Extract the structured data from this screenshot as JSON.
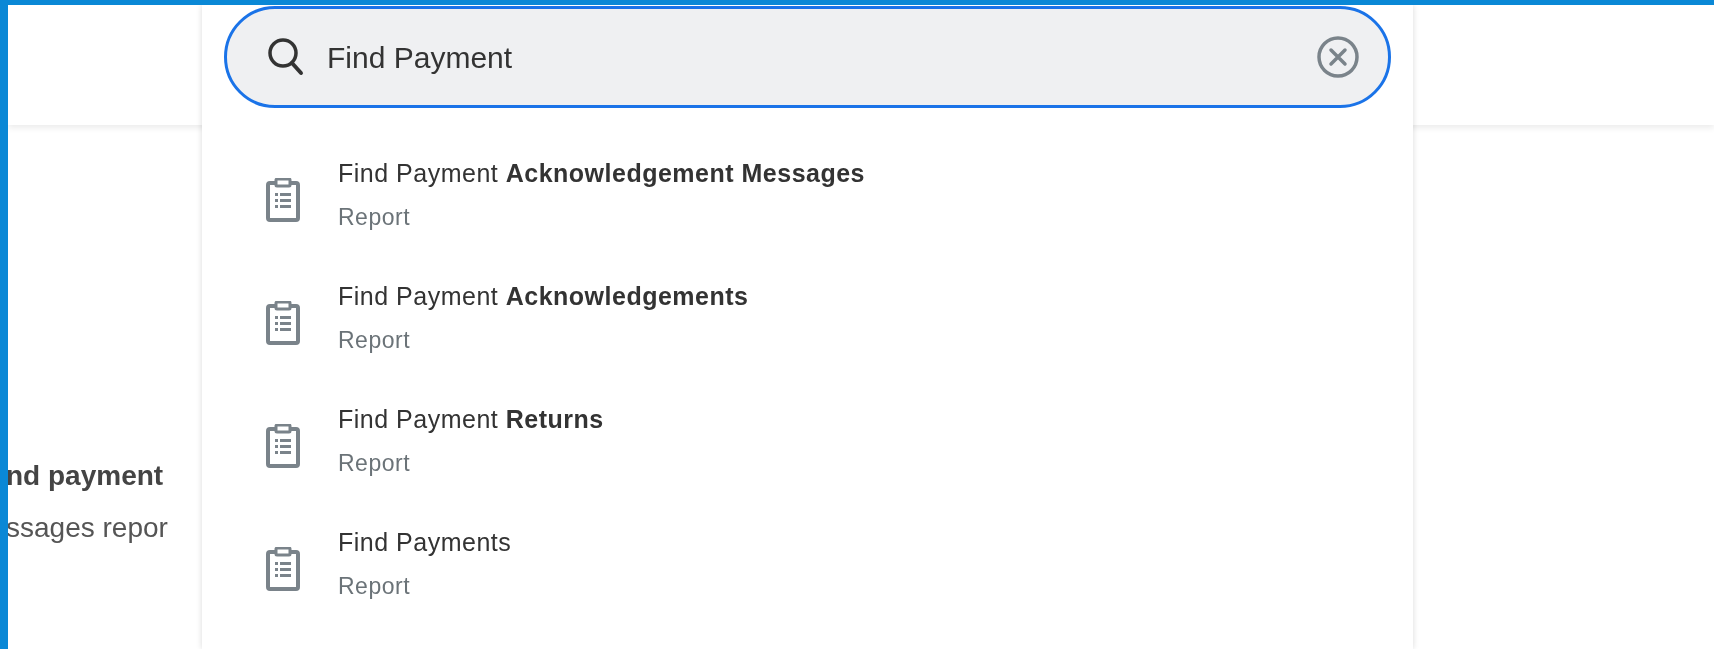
{
  "search": {
    "value": "Find Payment"
  },
  "results": [
    {
      "title": "Find Payment **Acknowledgement Messages**",
      "type": "Report"
    },
    {
      "title": "Find Payment **Acknowledgements**",
      "type": "Report"
    },
    {
      "title": "Find Payment **Returns**",
      "type": "Report"
    },
    {
      "title": "Find Payments",
      "type": "Report"
    }
  ],
  "background_text": [
    "**nd payment**",
    "ssages repor"
  ]
}
